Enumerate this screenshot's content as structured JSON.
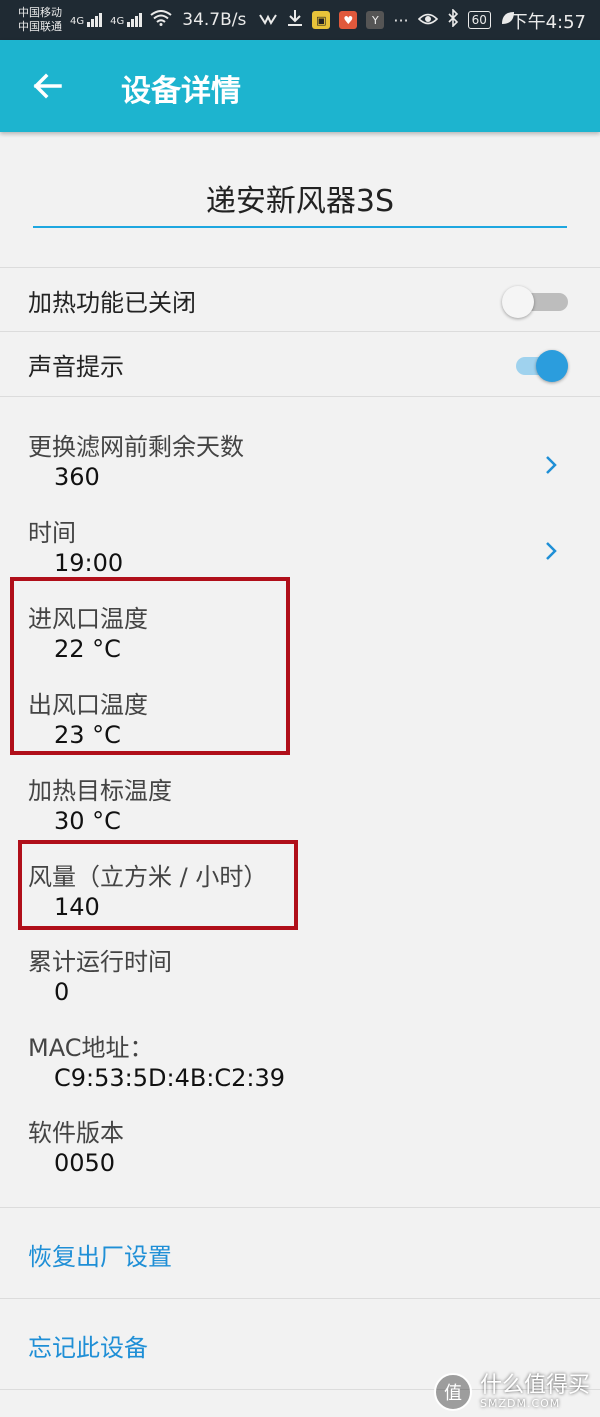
{
  "status_bar": {
    "carrier1": "中国移动",
    "carrier2": "中国联通",
    "net1": "4G",
    "net2": "4G",
    "speed": "34.7B/s",
    "battery": "60",
    "time": "下午4:57",
    "icons": [
      "wifi-icon",
      "link-icon",
      "download-icon",
      "app-icon-yellow",
      "pocket-icon",
      "app-icon-yi",
      "more-icon",
      "eye-icon",
      "bluetooth-icon",
      "leaf-icon"
    ]
  },
  "app_bar": {
    "title": "设备详情",
    "back_icon": "arrow-left-icon",
    "color": "#1db4cf"
  },
  "device_name": {
    "value": "递安新风器3S"
  },
  "toggles": [
    {
      "label": "加热功能已关闭",
      "state": "off"
    },
    {
      "label": "声音提示",
      "state": "on"
    }
  ],
  "info": [
    {
      "label": "更换滤网前剩余天数",
      "value": "360",
      "chevron": true
    },
    {
      "label": "时间",
      "value": "19:00",
      "chevron": true
    },
    {
      "label": "进风口温度",
      "value": "22 °C"
    },
    {
      "label": "出风口温度",
      "value": "23 °C"
    },
    {
      "label": "加热目标温度",
      "value": "30 °C"
    },
    {
      "label": "风量（立方米 / 小时）",
      "value": "140"
    },
    {
      "label": "累计运行时间",
      "value": "0"
    },
    {
      "label": "MAC地址：",
      "value": "C9:53:5D:4B:C2:39"
    },
    {
      "label": "软件版本",
      "value": "0050"
    }
  ],
  "actions": {
    "factory_reset": "恢复出厂设置",
    "forget_device": "忘记此设备"
  },
  "watermark": {
    "logo": "值",
    "text": "什么值得买",
    "sub": "SMZDM.COM"
  },
  "colors": {
    "accent": "#1db4cf",
    "link": "#1f8fd6",
    "toggle_on": "#2b9ddd",
    "highlight": "#b00f1a"
  }
}
